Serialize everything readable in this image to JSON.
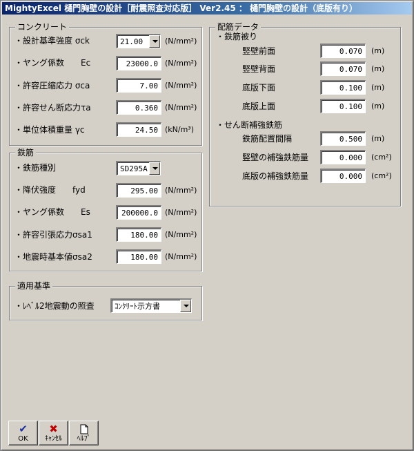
{
  "window": {
    "title": "MightyExcel 樋門胸壁の設計［耐震照査対応版］ Ver2.45 ： 樋門胸壁の設計（底版有り）"
  },
  "concrete": {
    "title": "コンクリート",
    "rows": [
      {
        "label": "・設計基準強度 σck",
        "value": "21.00",
        "unit": "(N/mm²)"
      },
      {
        "label": "・ヤング係数　　Ec",
        "value": "23000.0",
        "unit": "(N/mm²)"
      },
      {
        "label": "・許容圧縮応力 σca",
        "value": "7.00",
        "unit": "(N/mm²)"
      },
      {
        "label": "・許容せん断応力τa",
        "value": "0.360",
        "unit": "(N/mm²)"
      },
      {
        "label": "・単位体積重量 γc",
        "value": "24.50",
        "unit": "(kN/m³)"
      }
    ]
  },
  "rebar": {
    "title": "鉄筋",
    "rows": [
      {
        "label": "・鉄筋種別",
        "value": "SD295A",
        "unit": ""
      },
      {
        "label": "・降伏強度　　fyd",
        "value": "295.00",
        "unit": "(N/mm²)"
      },
      {
        "label": "・ヤング係数　　Es",
        "value": "200000.0",
        "unit": "(N/mm²)"
      },
      {
        "label": "・許容引張応力σsa1",
        "value": "180.00",
        "unit": "(N/mm²)"
      },
      {
        "label": "・地震時基本値σsa2",
        "value": "180.00",
        "unit": "(N/mm²)"
      }
    ]
  },
  "standard": {
    "title": "適用基準",
    "label": "・ﾚﾍﾞﾙ2地震動の照査",
    "value": "ｺﾝｸﾘｰﾄ示方書"
  },
  "layout_data": {
    "title": "配筋データ",
    "cover_header": "・鉄筋被り",
    "cover_rows": [
      {
        "label": "竪壁前面",
        "value": "0.070",
        "unit": "(m)"
      },
      {
        "label": "竪壁背面",
        "value": "0.070",
        "unit": "(m)"
      },
      {
        "label": "底版下面",
        "value": "0.100",
        "unit": "(m)"
      },
      {
        "label": "底版上面",
        "value": "0.100",
        "unit": "(m)"
      }
    ],
    "shear_header": "・せん断補強鉄筋",
    "shear_rows": [
      {
        "label": "鉄筋配置間隔",
        "value": "0.500",
        "unit": "(m)"
      },
      {
        "label": "竪壁の補強鉄筋量",
        "value": "0.000",
        "unit": "(cm²)"
      },
      {
        "label": "底版の補強鉄筋量",
        "value": "0.000",
        "unit": "(cm²)"
      }
    ]
  },
  "buttons": {
    "ok": "OK",
    "cancel": "ｷｬﾝｾﾙ",
    "help": "ﾍﾙﾌﾟ"
  }
}
